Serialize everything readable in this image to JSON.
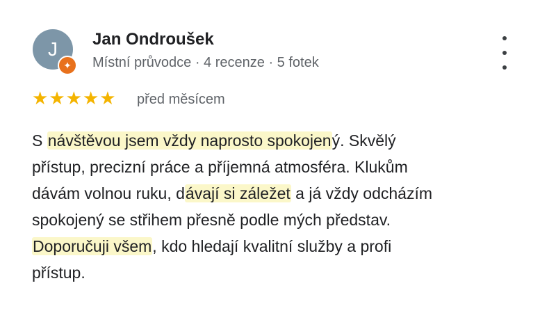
{
  "reviewer": {
    "avatar_letter": "J",
    "name": "Jan Ondroušek",
    "meta": "Místní průvodce · 4 recenze · 5 fotek"
  },
  "rating": {
    "stars": 5,
    "max": 5,
    "date": "před měsícem"
  },
  "review": {
    "line1": {
      "a": "S ",
      "hl1": "návštěvou jsem vždy naprosto spokojen",
      "b": "ý. Skvělý"
    },
    "line2": "přístup, precizní práce a příjemná atmosféra. Klukům",
    "line3": {
      "a": "dávám volnou ruku, d",
      "hl": "ávají si záležet",
      "b": " a já vždy odcházím"
    },
    "line4": "spokojený se střihem přesně podle mých představ.",
    "line5": {
      "hl": "Doporučuji všem",
      "b": ", kdo hledají kvalitní služby a profi"
    },
    "line6": "přístup."
  },
  "colors": {
    "star": "#f4b400",
    "highlight": "#fbf7c9",
    "avatar": "#7d96a8",
    "badge": "#e8711c"
  },
  "icons": {
    "badge": "local-guide-icon",
    "menu": "more-vert-icon",
    "star": "star-icon"
  }
}
